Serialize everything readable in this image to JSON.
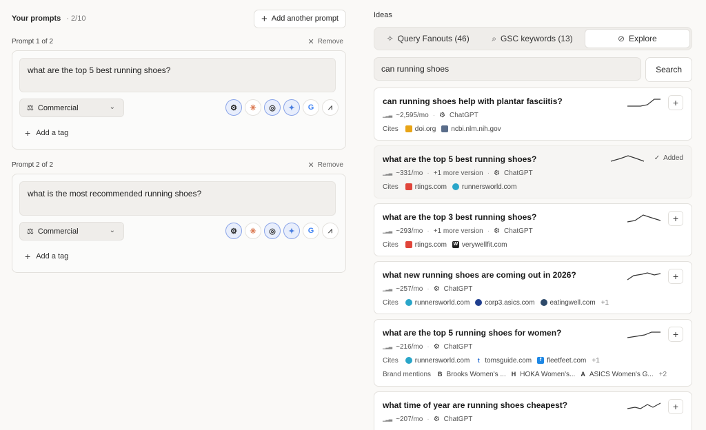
{
  "left": {
    "title": "Your prompts",
    "count": "2/10",
    "add_button": "Add another prompt",
    "prompts": [
      {
        "label": "Prompt 1 of 2",
        "remove": "Remove",
        "text": "what are the top 5 best running shoes?",
        "intent": "Commercial",
        "add_tag": "Add a tag"
      },
      {
        "label": "Prompt 2 of 2",
        "remove": "Remove",
        "text": "what is the most recommended running shoes?",
        "intent": "Commercial",
        "add_tag": "Add a tag"
      }
    ]
  },
  "right": {
    "title": "Ideas",
    "tabs": [
      {
        "label": "Query Fanouts (46)",
        "icon": "sparkle-icon"
      },
      {
        "label": "GSC keywords (13)",
        "icon": "search-icon"
      },
      {
        "label": "Explore",
        "icon": "compass-icon"
      }
    ],
    "search_value": "can running shoes",
    "search_button": "Search",
    "cites_label": "Cites",
    "brand_label": "Brand mentions",
    "added_label": "Added",
    "ideas": [
      {
        "q": "can running shoes help with plantar fasciitis?",
        "volume": "~2,595/mo",
        "model": "ChatGPT",
        "cites": [
          "doi.org",
          "ncbi.nlm.nih.gov"
        ]
      },
      {
        "q": "what are the top 5 best running shoes?",
        "volume": "~331/mo",
        "versions": "+1 more version",
        "model": "ChatGPT",
        "cites": [
          "rtings.com",
          "runnersworld.com"
        ]
      },
      {
        "q": "what are the top 3 best running shoes?",
        "volume": "~293/mo",
        "versions": "+1 more version",
        "model": "ChatGPT",
        "cites": [
          "rtings.com",
          "verywellfit.com"
        ]
      },
      {
        "q": "what new running shoes are coming out in 2026?",
        "volume": "~257/mo",
        "model": "ChatGPT",
        "cites": [
          "runnersworld.com",
          "corp3.asics.com",
          "eatingwell.com"
        ],
        "cites_more": "+1"
      },
      {
        "q": "what are the top 5 running shoes for women?",
        "volume": "~216/mo",
        "model": "ChatGPT",
        "cites": [
          "runnersworld.com",
          "tomsguide.com",
          "fleetfeet.com"
        ],
        "cites_more": "+1",
        "brands": [
          {
            "letter": "B",
            "name": "Brooks Women's ..."
          },
          {
            "letter": "H",
            "name": "HOKA Women's..."
          },
          {
            "letter": "A",
            "name": "ASICS Women's G..."
          }
        ],
        "brands_more": "+2"
      },
      {
        "q": "what time of year are running shoes cheapest?",
        "volume": "~207/mo",
        "model": "ChatGPT"
      }
    ]
  }
}
